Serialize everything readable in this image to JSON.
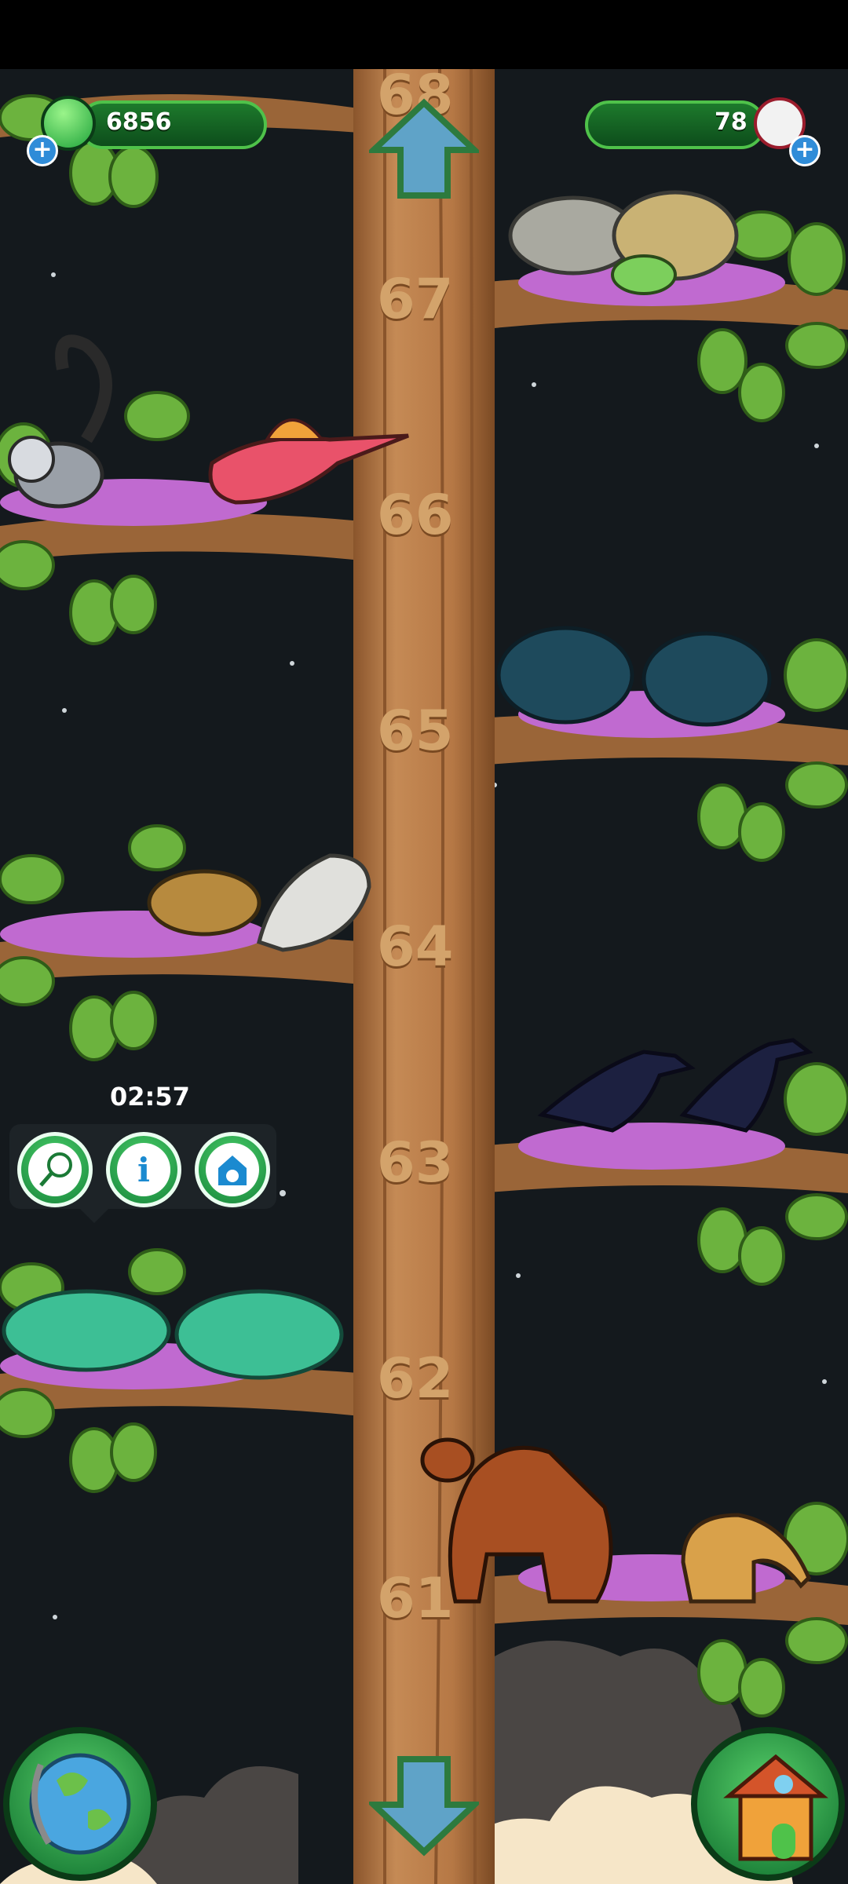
{
  "hud": {
    "currency_left": "6856",
    "currency_right": "78"
  },
  "levels": [
    "68",
    "67",
    "66",
    "65",
    "64",
    "63",
    "62",
    "61"
  ],
  "popup": {
    "timer": "02:57",
    "buttons": [
      {
        "name": "net-button",
        "icon": "net-icon"
      },
      {
        "name": "info-button",
        "icon": "info-icon"
      },
      {
        "name": "habitat-button",
        "icon": "house-animal-icon"
      }
    ]
  },
  "colors": {
    "background": "#14191d",
    "trunk": "#b67845",
    "hud_green": "#1d7a2c",
    "leaf": "#6cb33e",
    "nest_pink": "#c06ad0"
  },
  "animals": [
    "tortoise",
    "seal",
    "lemur",
    "spinosaurus",
    "beetle",
    "lion-cub",
    "crow",
    "lizard",
    "horse",
    "giraffe"
  ]
}
